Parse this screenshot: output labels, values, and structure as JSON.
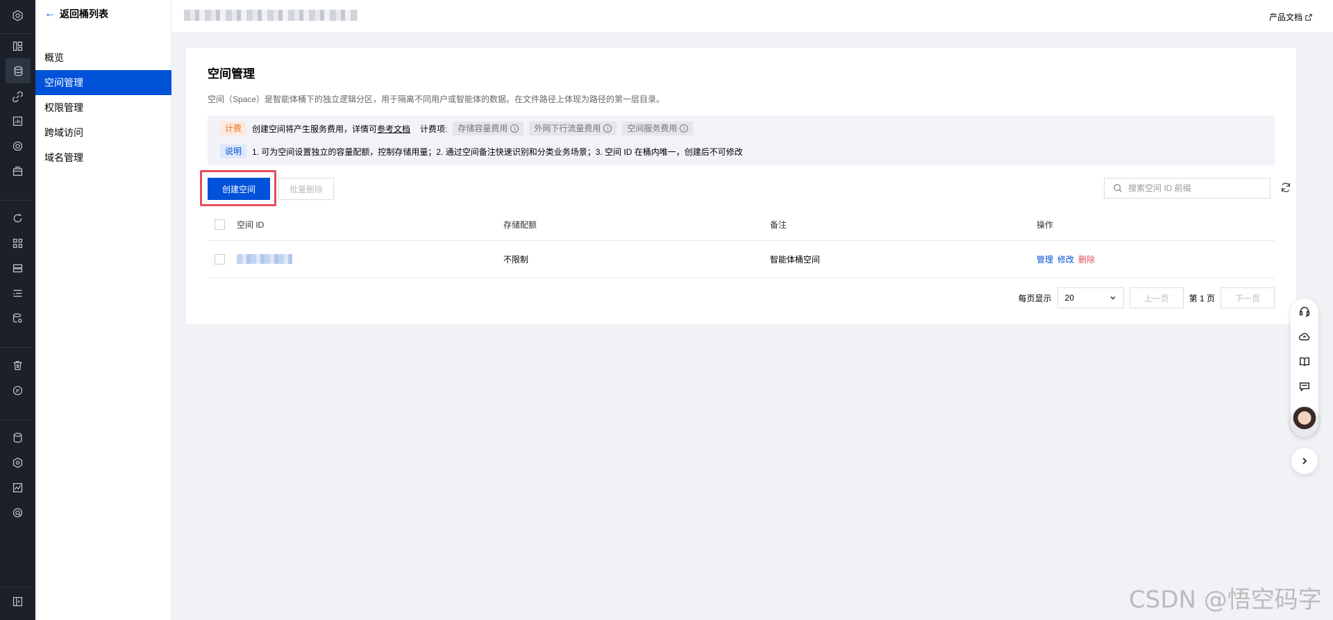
{
  "nav": {
    "back_label": "返回桶列表",
    "items": [
      {
        "label": "概览",
        "active": false
      },
      {
        "label": "空间管理",
        "active": true
      },
      {
        "label": "权限管理",
        "active": false
      },
      {
        "label": "跨域访问",
        "active": false
      },
      {
        "label": "域名管理",
        "active": false
      }
    ]
  },
  "header": {
    "product_doc_label": "产品文档"
  },
  "page": {
    "title": "空间管理",
    "description": "空间（Space）是智能体桶下的独立逻辑分区，用于隔离不同用户或智能体的数据。在文件路径上体现为路径的第一层目录。",
    "billing": {
      "tag": "计费",
      "text": "创建空间将产生服务费用，详情可",
      "link": "参考文档",
      "items_label": "计费项:",
      "items": [
        "存储容量费用",
        "外网下行流量费用",
        "空间服务费用"
      ]
    },
    "note": {
      "tag": "说明",
      "text": "1. 可为空间设置独立的容量配额，控制存储用量；2. 通过空间备注快速识别和分类业务场景；3. 空间 ID 在桶内唯一，创建后不可修改"
    }
  },
  "toolbar": {
    "create_label": "创建空间",
    "batch_delete_label": "批量删除",
    "search_placeholder": "搜索空间 ID 前缀"
  },
  "table": {
    "headers": {
      "id": "空间 ID",
      "quota": "存储配额",
      "note": "备注",
      "actions": "操作"
    },
    "rows": [
      {
        "quota": "不限制",
        "note": "智能体桶空间",
        "actions": [
          "管理",
          "修改",
          "删除"
        ]
      }
    ]
  },
  "pagination": {
    "per_page_label": "每页显示",
    "per_page_value": "20",
    "prev_label": "上一页",
    "page_text": "第 1 页",
    "next_label": "下一页"
  },
  "watermark": "CSDN @悟空码字",
  "colors": {
    "primary": "#0052d9",
    "danger": "#e34d59",
    "highlight": "#e34d59",
    "rail": "#1b2029"
  }
}
